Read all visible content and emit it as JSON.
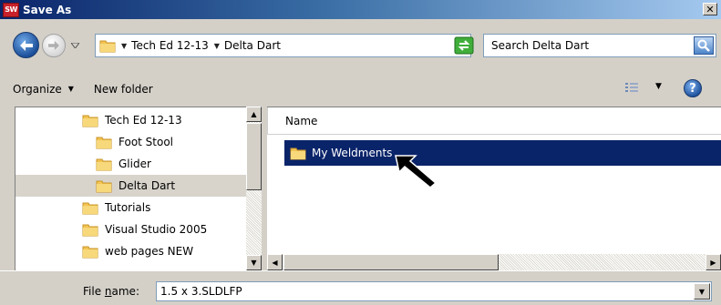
{
  "window": {
    "title": "Save As",
    "app_icon_text": "SW",
    "close_glyph": "✕"
  },
  "address": {
    "crumbs": [
      "Tech Ed 12-13",
      "Delta Dart"
    ],
    "crumb_arrow": "▼",
    "dropdown_arrow": "▼"
  },
  "search": {
    "placeholder": "Search Delta Dart"
  },
  "toolbar": {
    "organize_label": "Organize",
    "organize_arrow": "▼",
    "new_folder_label": "New folder",
    "view_arrow": "▼",
    "help_glyph": "?"
  },
  "nav_tree": {
    "items": [
      {
        "label": "Tech Ed 12-13",
        "icon": "folder-icon",
        "indent": 1
      },
      {
        "label": "Foot Stool",
        "icon": "folder-icon",
        "indent": 2
      },
      {
        "label": "Glider",
        "icon": "folder-icon",
        "indent": 2
      },
      {
        "label": "Delta Dart",
        "icon": "folder-icon",
        "indent": 2,
        "selected": true
      },
      {
        "label": "Tutorials",
        "icon": "folder-icon",
        "indent": 1
      },
      {
        "label": "Visual Studio 2005",
        "icon": "folder-icon",
        "indent": 1
      },
      {
        "label": "web pages NEW",
        "icon": "folder-icon",
        "indent": 1
      }
    ]
  },
  "file_list": {
    "column_name": "Name",
    "items": [
      {
        "label": "My Weldments",
        "icon": "folder-icon",
        "selected": true
      }
    ]
  },
  "file_name": {
    "label_prefix": "File ",
    "label_accel": "n",
    "label_suffix": "ame:",
    "value": "1.5 x 3.SLDLFP"
  },
  "colors": {
    "title_start": "#0a246a",
    "title_end": "#a6caf0",
    "selection": "#0a246a",
    "folder": "#f3c452"
  }
}
